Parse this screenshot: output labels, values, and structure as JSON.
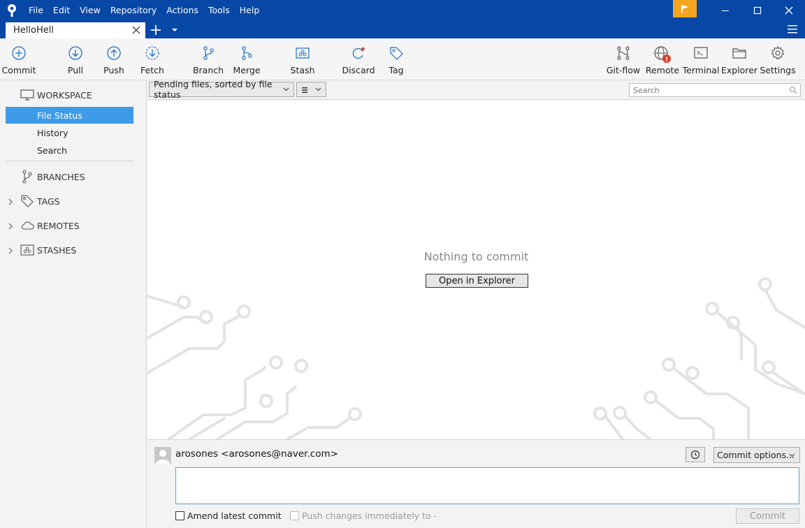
{
  "titlebar": {
    "menu": [
      "File",
      "Edit",
      "View",
      "Repository",
      "Actions",
      "Tools",
      "Help"
    ],
    "brand_color": "#0747a6",
    "flag_color": "#f6a51f"
  },
  "tabs": {
    "active_label": "HelloHell"
  },
  "toolbar": {
    "commit": "Commit",
    "pull": "Pull",
    "push": "Push",
    "fetch": "Fetch",
    "branch": "Branch",
    "merge": "Merge",
    "stash": "Stash",
    "discard": "Discard",
    "tag": "Tag",
    "gitflow": "Git-flow",
    "remote": "Remote",
    "terminal": "Terminal",
    "explorer": "Explorer",
    "settings": "Settings",
    "remote_badge": "!"
  },
  "sidebar": {
    "workspace": "WORKSPACE",
    "items": [
      "File Status",
      "History",
      "Search"
    ],
    "branches": "BRANCHES",
    "tags": "TAGS",
    "remotes": "REMOTES",
    "stashes": "STASHES",
    "active_color": "#3d9be9"
  },
  "filterbar": {
    "sort_label": "Pending files, sorted by file status",
    "view_icon": "≣",
    "search_placeholder": "Search"
  },
  "main": {
    "empty_message": "Nothing to commit",
    "open_button": "Open in Explorer"
  },
  "commit_panel": {
    "author": "arosones <arosones@naver.com>",
    "options_label": "Commit options...",
    "amend_label": "Amend latest commit",
    "push_label": "Push changes immediately to -",
    "commit_button": "Commit"
  }
}
